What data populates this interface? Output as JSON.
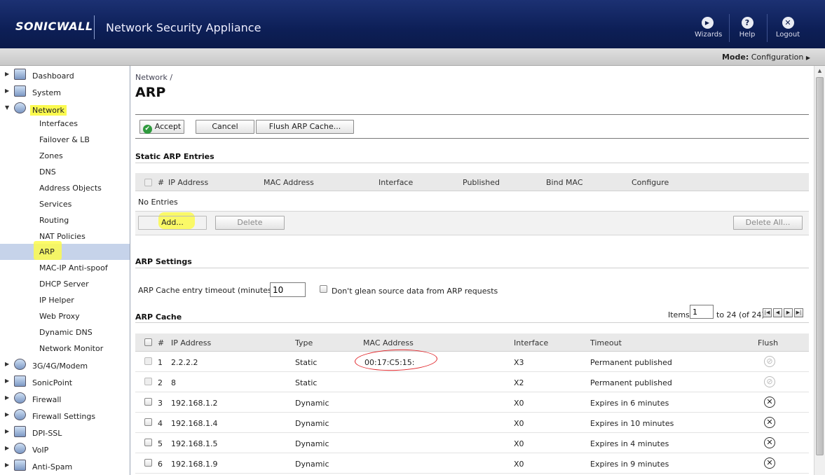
{
  "header": {
    "logo": "SONICWALL",
    "app_title": "Network Security Appliance",
    "buttons": [
      {
        "label": "Wizards",
        "icon": "play-icon",
        "glyph": "▶"
      },
      {
        "label": "Help",
        "icon": "help-icon",
        "glyph": "?"
      },
      {
        "label": "Logout",
        "icon": "logout-icon",
        "glyph": "✕"
      }
    ]
  },
  "mode_bar": {
    "label": "Mode:",
    "value": "Configuration",
    "arrow": "▶"
  },
  "sidebar": {
    "top_items": [
      {
        "label": "Dashboard",
        "arrow": "▶",
        "icon": "dashboard-icon"
      },
      {
        "label": "System",
        "arrow": "▶",
        "icon": "monitor-icon"
      },
      {
        "label": "Network",
        "arrow": "▼",
        "icon": "globe-icon"
      }
    ],
    "network_items": [
      {
        "label": "Interfaces"
      },
      {
        "label": "Failover & LB"
      },
      {
        "label": "Zones"
      },
      {
        "label": "DNS"
      },
      {
        "label": "Address Objects"
      },
      {
        "label": "Services"
      },
      {
        "label": "Routing"
      },
      {
        "label": "NAT Policies"
      },
      {
        "label": "ARP"
      },
      {
        "label": "MAC-IP Anti-spoof"
      },
      {
        "label": "DHCP Server"
      },
      {
        "label": "IP Helper"
      },
      {
        "label": "Web Proxy"
      },
      {
        "label": "Dynamic DNS"
      },
      {
        "label": "Network Monitor"
      }
    ],
    "bottom_items": [
      {
        "label": "3G/4G/Modem",
        "arrow": "▶",
        "icon": "modem-icon"
      },
      {
        "label": "SonicPoint",
        "arrow": "▶",
        "icon": "sonicpoint-icon"
      },
      {
        "label": "Firewall",
        "arrow": "▶",
        "icon": "firewall-icon"
      },
      {
        "label": "Firewall Settings",
        "arrow": "▶",
        "icon": "firewall-settings-icon"
      },
      {
        "label": "DPI-SSL",
        "arrow": "▶",
        "icon": "dpi-ssl-icon"
      },
      {
        "label": "VoIP",
        "arrow": "▶",
        "icon": "voip-icon"
      },
      {
        "label": "Anti-Spam",
        "arrow": "▶",
        "icon": "anti-spam-icon"
      }
    ]
  },
  "main": {
    "breadcrumb": "Network /",
    "title": "ARP",
    "toolbar": {
      "accept": "Accept",
      "cancel": "Cancel",
      "flush": "Flush ARP Cache..."
    },
    "static": {
      "title": "Static ARP Entries",
      "columns": [
        "#",
        "IP Address",
        "MAC Address",
        "Interface",
        "Published",
        "Bind MAC",
        "Configure"
      ],
      "empty": "No Entries",
      "add": "Add...",
      "delete": "Delete",
      "delete_all": "Delete All..."
    },
    "settings": {
      "title": "ARP Settings",
      "timeout_label": "ARP Cache entry timeout (minutes):",
      "timeout_value": "10",
      "glean_label": "Don't glean source data from ARP requests"
    },
    "cache": {
      "title": "ARP Cache",
      "items_label": "Items",
      "items_value": "1",
      "range": "to 24 (of 24)",
      "columns": [
        "#",
        "IP Address",
        "Type",
        "MAC Address",
        "Interface",
        "Timeout",
        "Flush"
      ],
      "rows": [
        {
          "num": "1",
          "ip": "2.2.2.2",
          "type": "Static",
          "mac": "00:17:C5:15:",
          "iface": "X3",
          "timeout": "Permanent published",
          "flush": "⊘",
          "dim": true
        },
        {
          "num": "2",
          "ip": "8",
          "type": "Static",
          "mac": "",
          "iface": "X2",
          "timeout": "Permanent published",
          "flush": "⊘",
          "dim": true
        },
        {
          "num": "3",
          "ip": "192.168.1.2",
          "type": "Dynamic",
          "mac": "",
          "iface": "X0",
          "timeout": "Expires in 6 minutes",
          "flush": "✕",
          "dim": false
        },
        {
          "num": "4",
          "ip": "192.168.1.4",
          "type": "Dynamic",
          "mac": "",
          "iface": "X0",
          "timeout": "Expires in 10 minutes",
          "flush": "✕",
          "dim": false
        },
        {
          "num": "5",
          "ip": "192.168.1.5",
          "type": "Dynamic",
          "mac": "",
          "iface": "X0",
          "timeout": "Expires in 4 minutes",
          "flush": "✕",
          "dim": false
        },
        {
          "num": "6",
          "ip": "192.168.1.9",
          "type": "Dynamic",
          "mac": "",
          "iface": "X0",
          "timeout": "Expires in 9 minutes",
          "flush": "✕",
          "dim": false
        }
      ]
    }
  },
  "colors": {
    "header": "#0d1f57",
    "highlight": "#fbfa4f",
    "annotation": "#e1252a",
    "active_row": "#c6d3ea"
  }
}
